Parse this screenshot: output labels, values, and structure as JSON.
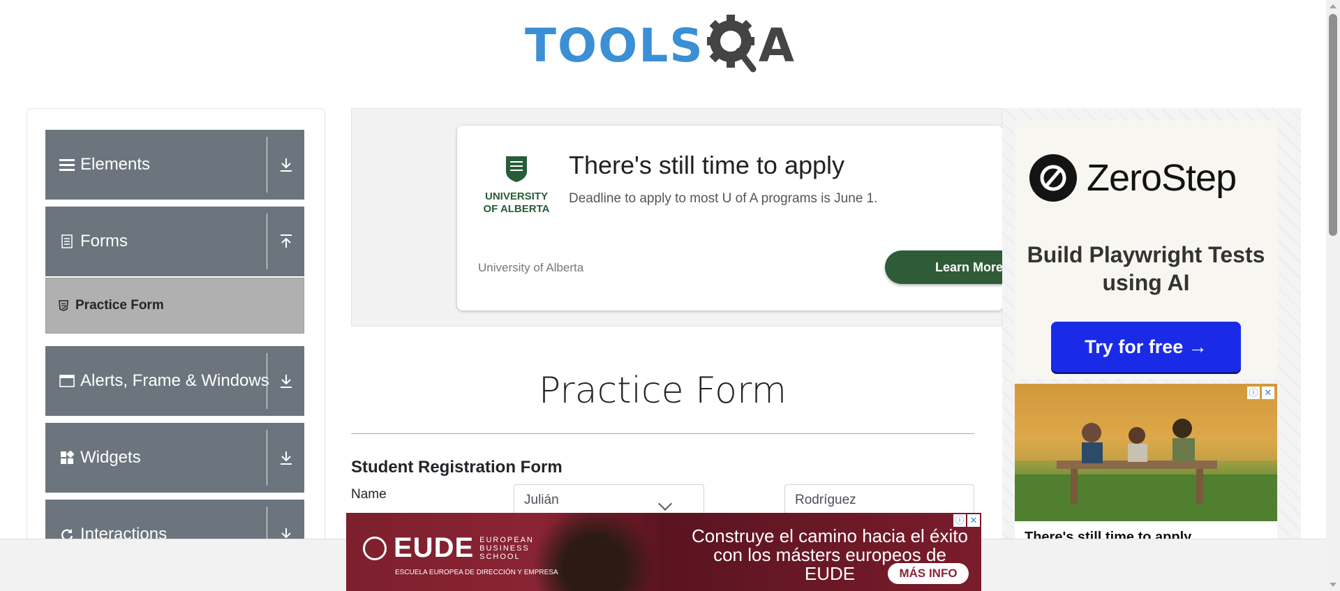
{
  "logo": {
    "text_tools": "TOOLS",
    "text_a": "A",
    "colors": {
      "tools": "#3b8fd5",
      "qa": "#444444"
    }
  },
  "sidebar": {
    "groups": [
      {
        "label": "Elements",
        "icon": "hamburger-icon",
        "arrow": "download-arrow-icon"
      },
      {
        "label": "Forms",
        "icon": "document-icon",
        "arrow": "upload-arrow-icon"
      },
      {
        "label": "Alerts, Frame & Windows",
        "icon": "window-icon",
        "arrow": "download-arrow-icon"
      },
      {
        "label": "Widgets",
        "icon": "grid-icon",
        "arrow": "download-arrow-icon"
      },
      {
        "label": "Interactions",
        "icon": "refresh-icon",
        "arrow": "download-arrow-icon"
      }
    ],
    "forms_items": [
      {
        "label": "Practice Form",
        "icon": "html5-icon",
        "active": true
      }
    ]
  },
  "main_ad": {
    "university": "UNIVERSITY OF ALBERTA",
    "headline": "There's still time to apply",
    "subline": "Deadline to apply to most U of A programs is June 1.",
    "advertiser": "University of Alberta",
    "cta": "Learn More",
    "cta_color": "#2f5b38"
  },
  "right_ad": {
    "brand": "ZeroStep",
    "tagline": "Build Playwright Tests using AI",
    "cta": "Try for free →",
    "cta_color": "#1a2be8",
    "caption": "There's still time to apply"
  },
  "form": {
    "title": "Practice Form",
    "subtitle": "Student Registration Form",
    "name_label": "Name",
    "first_name": "Julián",
    "last_name": "Rodríguez"
  },
  "bottom_ad": {
    "brand": "EUDE",
    "brand_sub": "EUROPEAN BUSINESS SCHOOL",
    "tag": "ESCUELA EUROPEA DE DIRECCIÓN Y EMPRESA",
    "headline": "Construye el camino hacia el éxito con los másters europeos de EUDE",
    "cta": "MÁS INFO"
  }
}
